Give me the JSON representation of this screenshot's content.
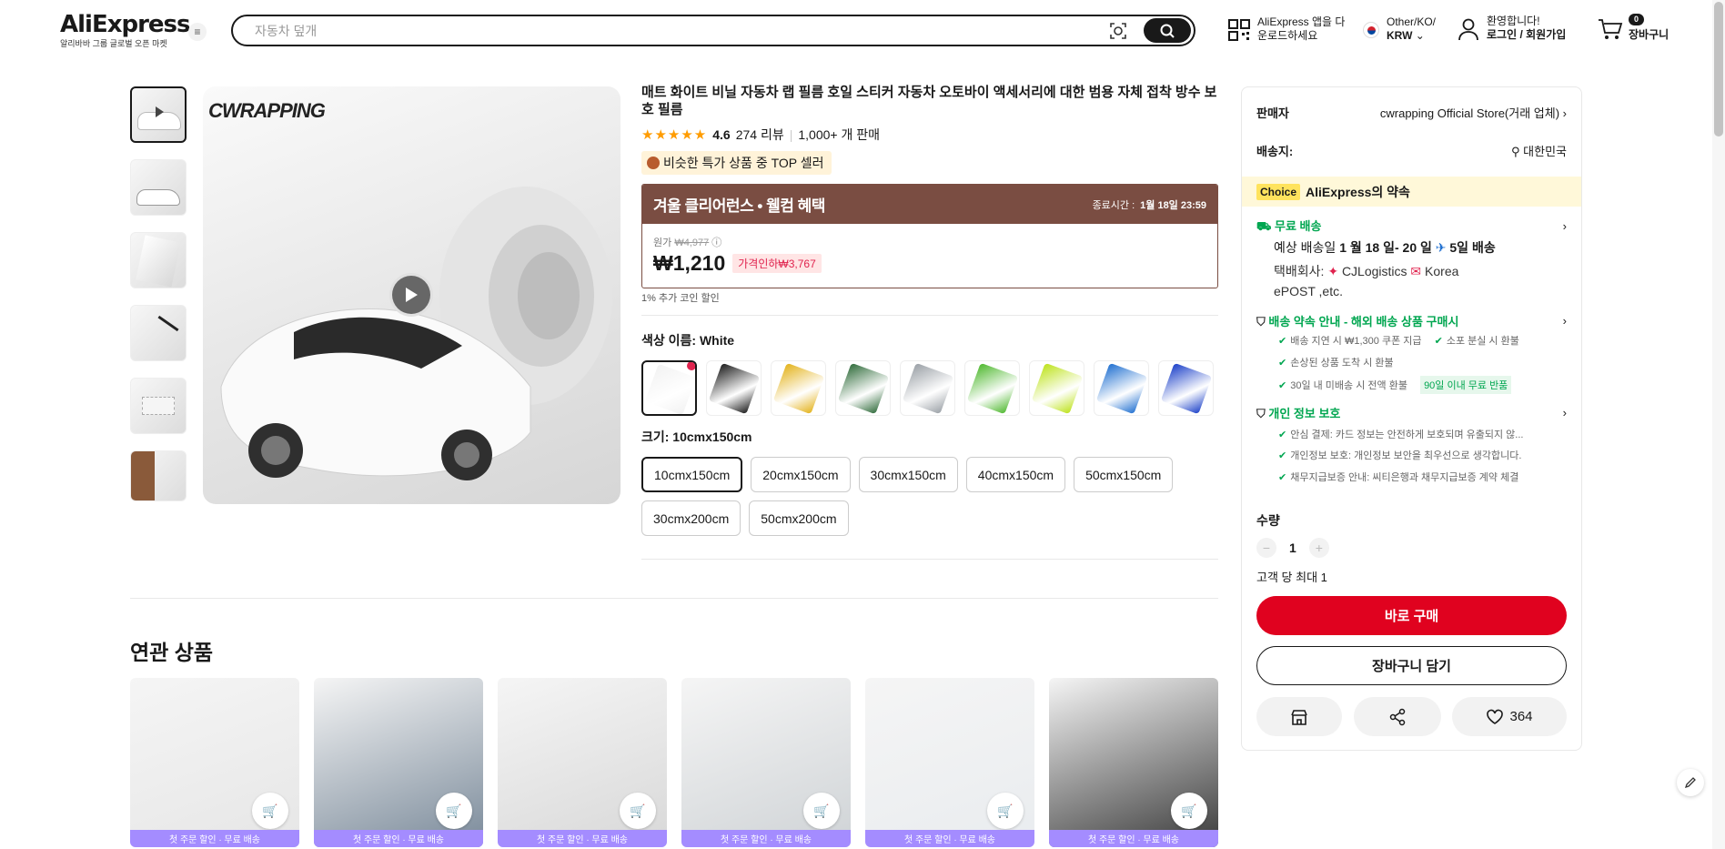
{
  "header": {
    "logo": "AliExpress",
    "logo_sub": "알리바바 그룹 글로벌 오픈 마켓",
    "search_placeholder": "자동차 덮개",
    "app_line1": "AliExpress 앱을 다",
    "app_line2": "운로드하세요",
    "locale_line1": "Other/KO/",
    "locale_line2": "KRW",
    "greeting": "환영합니다!",
    "login": "로그인 / 회원가입",
    "cart_count": "0",
    "cart_label": "장바구니"
  },
  "gallery": {
    "brand_logo": "CWRAPPING"
  },
  "product": {
    "title": "매트 화이트 비닐 자동차 랩 필름 호일 스티커 자동차 오토바이 액세서리에 대한 범용 자체 접착 방수 보호 필름",
    "rating": "4.6",
    "reviews": "274 리뷰",
    "sold": "1,000+ 개 판매",
    "top_seller": "비슷한 특가 상품 중 TOP 셀러",
    "promo_title": "겨울 클리어런스 • 웰컴 혜택",
    "promo_end_label": "종료시간 :",
    "promo_end_value": "1월 18일 23:59",
    "orig_label": "원가",
    "orig_price": "₩4,977",
    "price": "₩1,210",
    "discount": "가격인하₩3,767",
    "coin": "1% 추가 코인 할인",
    "color_label": "색상 이름: White",
    "size_label": "크기: 10cmx150cm",
    "swatch_colors": [
      "#f2f2f2",
      "#1b1b1b",
      "#e3b21a",
      "#2f6b3a",
      "#9aa0a6",
      "#4eb82e",
      "#bde21a",
      "#1f6fd0",
      "#1a3fc8"
    ],
    "sizes": [
      "10cmx150cm",
      "20cmx150cm",
      "30cmx150cm",
      "40cmx150cm",
      "50cmx150cm",
      "30cmx200cm",
      "50cmx200cm"
    ]
  },
  "panel": {
    "seller_label": "판매자",
    "seller_value": "cwrapping Official Store(거래 업체)",
    "ship_label": "배송지:",
    "ship_value": "대한민국",
    "choice_tag": "Choice",
    "choice_text": "AliExpress의 약속",
    "free_ship": "무료 배송",
    "eta_pre": "예상 배송일",
    "eta_dates": "1 월 18 일- 20 일",
    "eta_post": "5일 배송",
    "carrier_label": "택배회사:",
    "carrier_1": "CJLogistics",
    "carrier_2": "Korea",
    "carrier_3": "ePOST ,etc.",
    "delivery_promise": "배송 약속 안내 - 해외 배송 상품 구매시",
    "dp_1": "배송 지연 시 ₩1,300 쿠폰 지급",
    "dp_2": "소포 분실 시 환불",
    "dp_3": "손상된 상품 도착 시 환불",
    "dp_4": "30일 내 미배송 시 전액 환불",
    "dp_tag": "90일 이내 무료 반품",
    "privacy": "개인 정보 보호",
    "pv_1": "안심 결제: 카드 정보는 안전하게 보호되며 유출되지 않...",
    "pv_2": "개인정보 보호: 개인정보 보안을 최우선으로 생각합니다.",
    "pv_3": "채무지급보증 안내: 씨티은행과 채무지급보증 계약 체결",
    "qty_label": "수량",
    "qty_value": "1",
    "qty_max": "고객 당 최대 1",
    "buy_now": "바로 구매",
    "add_cart": "장바구니 담기",
    "wishlist_count": "364"
  },
  "related": {
    "title": "연관 상품",
    "strip": "첫 주문 할인 · 무료 배송",
    "cards": [
      {
        "bg": "#e6e6e6"
      },
      {
        "bg": "#7a8a9a"
      },
      {
        "bg": "#d8d8d8"
      },
      {
        "bg": "#cfd3d6"
      },
      {
        "bg": "#e9ecef"
      },
      {
        "bg": "#3a3a3a"
      }
    ]
  }
}
